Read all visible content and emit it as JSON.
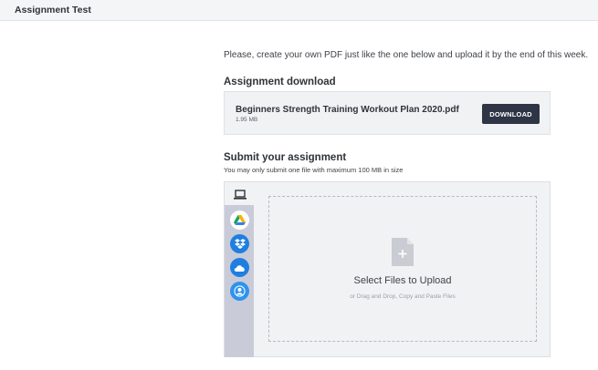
{
  "header": {
    "title": "Assignment Test"
  },
  "intro": {
    "text": "Please, create your own PDF just like the one below and upload it by the end of this week."
  },
  "download": {
    "heading": "Assignment download",
    "file_name": "Beginners Strength Training Workout Plan 2020.pdf",
    "file_size": "1.95 MB",
    "button_label": "DOWNLOAD"
  },
  "submit": {
    "heading": "Submit your assignment",
    "note": "You may only submit one file with maximum 100 MB in size",
    "sources": [
      "laptop-icon",
      "google-drive-icon",
      "dropbox-icon",
      "onedrive-icon",
      "user-icon"
    ],
    "dropzone": {
      "title": "Select Files to Upload",
      "hint": "or Drag and Drop, Copy and Paste Files"
    }
  },
  "colors": {
    "button_bg": "#2e3545",
    "rail_bg": "#c9ccd8",
    "source_blue": "#1f7fe0"
  }
}
